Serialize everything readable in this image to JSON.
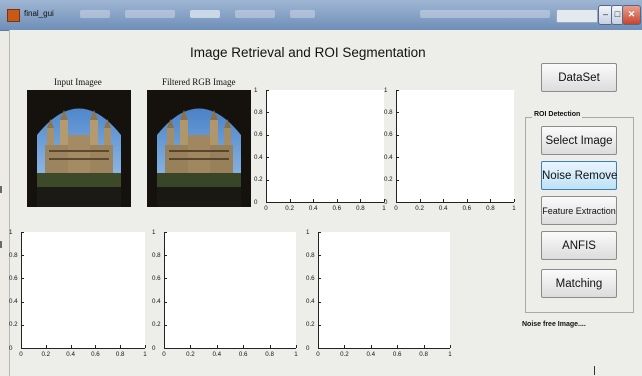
{
  "window": {
    "title": "final_gui",
    "buttons": {
      "minimize": "–",
      "maximize": "□",
      "close": "✕"
    }
  },
  "heading": "Image Retrieval and ROI Segmentation",
  "images": {
    "input_label": "Input Imagee",
    "filtered_label": "Filtered RGB Image"
  },
  "axes": {
    "y_ticks": [
      "1",
      "0.8",
      "0.6",
      "0.4",
      "0.2",
      "0"
    ],
    "x_ticks": [
      "0",
      "0.2",
      "0.4",
      "0.6",
      "0.8",
      "1"
    ]
  },
  "buttons": {
    "dataset": "DataSet",
    "select_image": "Select Image",
    "noise_remove": "Noise Remove",
    "feature_extraction": "Feature Extraction",
    "anfis": "ANFIS",
    "matching": "Matching"
  },
  "group_title": "ROI Detection",
  "status_text": "Noise free Image....",
  "colors": {
    "active_button": "#bfe2f7",
    "titlebar": "#6f8fb8"
  }
}
